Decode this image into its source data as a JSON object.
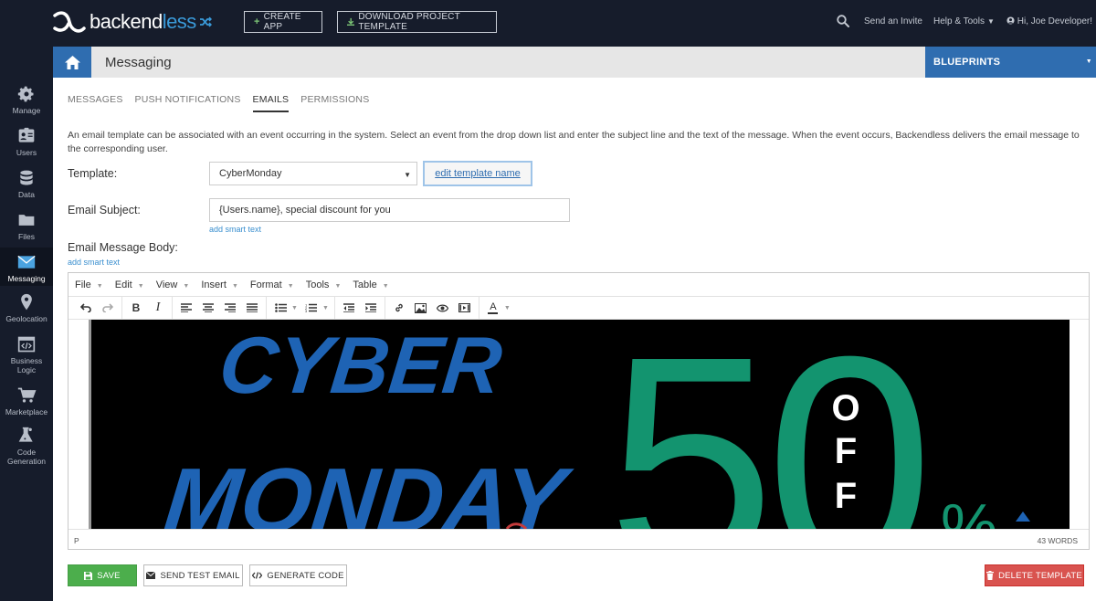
{
  "app": {
    "logo_text_main": "backend",
    "logo_text_accent": "less"
  },
  "topbar": {
    "create_app": "CREATE APP",
    "download_template": "DOWNLOAD PROJECT TEMPLATE",
    "send_invite": "Send an Invite",
    "help_tools": "Help & Tools",
    "user_greeting": "Hi, Joe Developer!"
  },
  "sidebar": {
    "items": [
      {
        "label": "Manage",
        "icon": "gear-icon"
      },
      {
        "label": "Users",
        "icon": "users-icon"
      },
      {
        "label": "Data",
        "icon": "database-icon"
      },
      {
        "label": "Files",
        "icon": "folder-icon"
      },
      {
        "label": "Messaging",
        "icon": "envelope-icon",
        "active": true
      },
      {
        "label": "Geolocation",
        "icon": "map-pin-icon"
      },
      {
        "label": "Business Logic",
        "icon": "code-window-icon"
      },
      {
        "label": "Marketplace",
        "icon": "cart-icon"
      },
      {
        "label": "Code Generation",
        "icon": "flask-icon"
      }
    ]
  },
  "header": {
    "title": "Messaging",
    "blueprints": "BLUEPRINTS"
  },
  "tabs": [
    {
      "label": "MESSAGES"
    },
    {
      "label": "PUSH NOTIFICATIONS"
    },
    {
      "label": "EMAILS",
      "active": true
    },
    {
      "label": "PERMISSIONS"
    }
  ],
  "description": "An email template can be associated with an event occurring in the system. Select an event from the drop down list and enter the subject line and the text of the message. When the event occurs, Backendless delivers the email message to the corresponding user.",
  "form": {
    "template_label": "Template:",
    "template_value": "CyberMonday",
    "edit_template_name": "edit template name",
    "subject_label": "Email Subject:",
    "subject_value": "{Users.name}, special discount for you",
    "add_smart_text": "add smart text",
    "body_label": "Email Message Body:"
  },
  "editor": {
    "menus": [
      "File",
      "Edit",
      "View",
      "Insert",
      "Format",
      "Tools",
      "Table"
    ],
    "status_path": "P",
    "word_count": "43 WORDS",
    "banner": {
      "line1": "CYBER",
      "line2": "MONDAY",
      "number": "50",
      "off": [
        "O",
        "F",
        "F"
      ],
      "percent": "%",
      "colors": {
        "blue": "#1e63b4",
        "green": "#13946f",
        "background": "#000000"
      }
    }
  },
  "actions": {
    "save": "SAVE",
    "send_test": "SEND TEST EMAIL",
    "generate_code": "GENERATE CODE",
    "delete": "DELETE TEMPLATE"
  },
  "colors": {
    "topbar": "#161c2b",
    "primary": "#2f6db0",
    "success": "#4cae4c",
    "danger": "#d9534f"
  }
}
